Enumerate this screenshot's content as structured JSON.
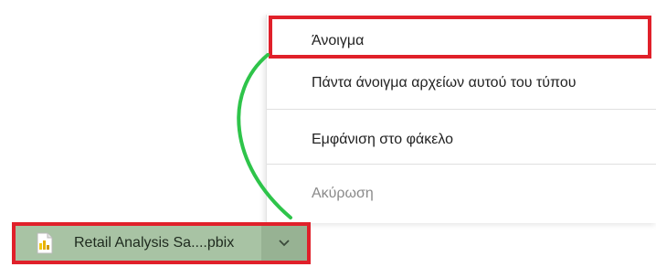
{
  "context_menu": {
    "items": [
      {
        "label": "Άνοιγμα",
        "enabled": true,
        "highlighted": true
      },
      {
        "label": "Πάντα άνοιγμα αρχείων αυτού του τύπου",
        "enabled": true
      },
      {
        "label": "Εμφάνιση στο φάκελο",
        "enabled": true
      },
      {
        "label": "Ακύρωση",
        "enabled": false
      }
    ]
  },
  "download_item": {
    "file_name": "Retail Analysis Sa....pbix",
    "file_icon": "pbix-file-icon",
    "menu_icon": "chevron-down-icon",
    "highlighted": true
  },
  "colors": {
    "highlight_border": "#e0202a",
    "connector_line": "#2ec44a",
    "download_item_bg": "#a8c3a4"
  }
}
